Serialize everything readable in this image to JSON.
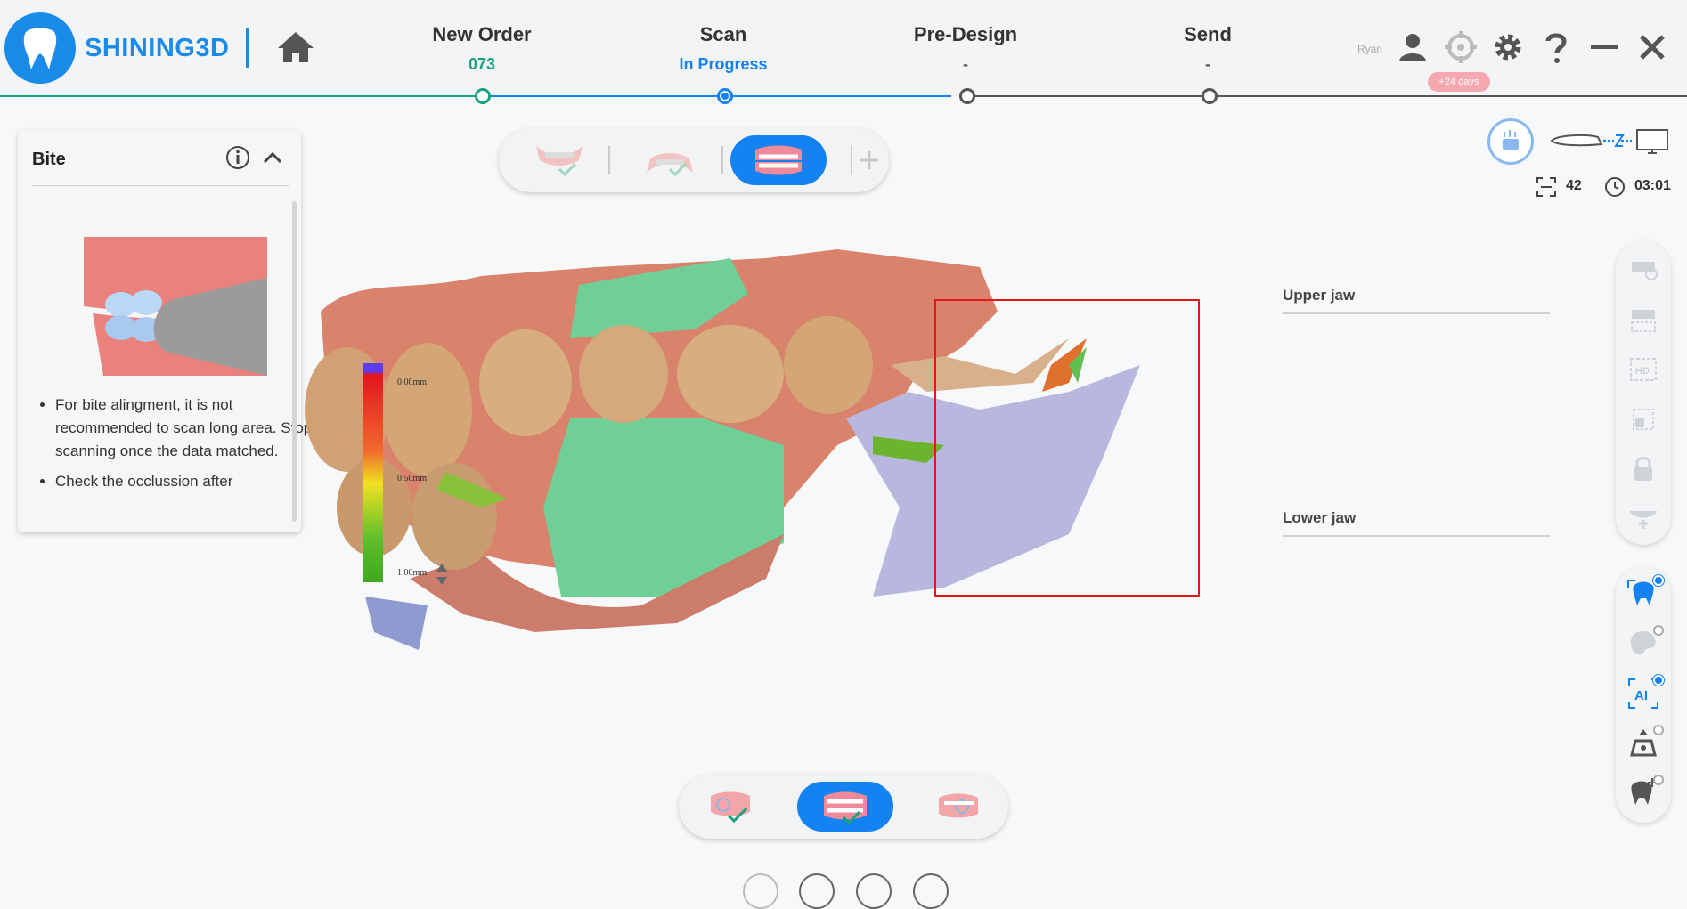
{
  "app": {
    "brand": "SHINING3D",
    "user": "Ryan",
    "trial_badge": "+24 days"
  },
  "steps": [
    {
      "name": "New Order",
      "sub": "073",
      "sub_color": "#1aa37a"
    },
    {
      "name": "Scan",
      "sub": "In Progress",
      "sub_color": "#1482f0"
    },
    {
      "name": "Pre-Design",
      "sub": "-",
      "sub_color": "#555555"
    },
    {
      "name": "Send",
      "sub": "-",
      "sub_color": "#555555"
    }
  ],
  "bite_panel": {
    "title": "Bite",
    "tips": [
      "For bite alingment, it is not recommended to scan long area. Stop scanning once the data matched.",
      "Check the occlussion after"
    ]
  },
  "status": {
    "frame_count": "42",
    "timer": "03:01"
  },
  "jaw_labels": {
    "upper": "Upper jaw",
    "lower": "Lower jaw"
  },
  "deviation_scale": {
    "labels": [
      "0.00mm",
      "0.50mm",
      "1.00mm"
    ]
  },
  "colors": {
    "accent": "#1482f0",
    "brand": "#1a8be8",
    "progress_done": "#1aa37a",
    "roi_box": "#e8141e"
  },
  "icons": {
    "home": "home-icon",
    "user": "user-icon",
    "target": "target-icon",
    "settings": "gear-icon",
    "help": "help-icon",
    "minimize": "minimize-icon",
    "close": "close-icon"
  }
}
